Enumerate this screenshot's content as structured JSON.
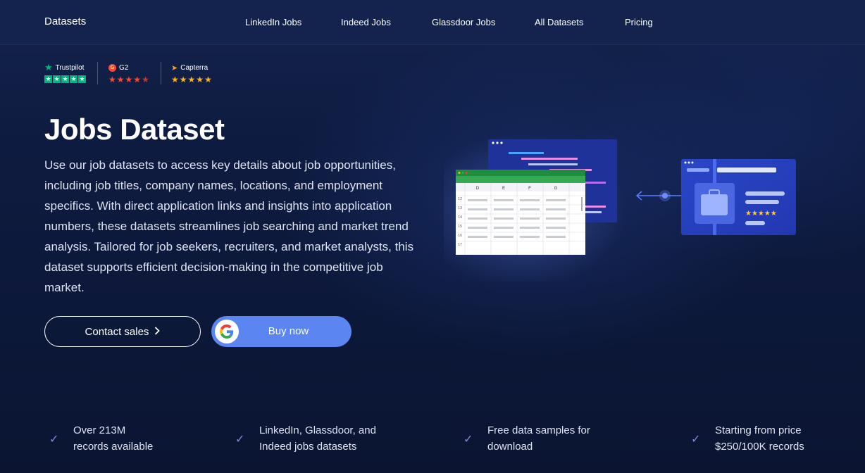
{
  "nav": {
    "brand": "Datasets",
    "links": [
      "LinkedIn Jobs",
      "Indeed Jobs",
      "Glassdoor Jobs",
      "All Datasets",
      "Pricing"
    ]
  },
  "ratings": {
    "trustpilot": "Trustpilot",
    "g2": "G2",
    "capterra": "Capterra"
  },
  "hero": {
    "title": "Jobs Dataset",
    "description": "Use our job datasets to access key details about job opportunities, including job titles, company names, locations, and employment specifics. With direct application links and insights into application numbers, these datasets streamlines job searching and market trend analysis. Tailored for job seekers, recruiters, and market analysts, this dataset supports efficient decision-making in the competitive job market."
  },
  "buttons": {
    "contact": "Contact sales",
    "buy": "Buy now"
  },
  "illustration": {
    "columns": [
      "D",
      "E",
      "F",
      "G"
    ],
    "rows": [
      "12",
      "13",
      "14",
      "15",
      "16",
      "17"
    ]
  },
  "features": [
    {
      "line1": "Over 213M",
      "line2": "records available"
    },
    {
      "line1": "LinkedIn, Glassdoor, and",
      "line2": "Indeed jobs datasets"
    },
    {
      "line1": "Free data samples for",
      "line2": "download"
    },
    {
      "line1": "Starting from price",
      "line2": "$250/100K records"
    }
  ],
  "colors": {
    "background": "#0b1532",
    "nav": "#13234d",
    "accent": "#5b85f0",
    "trustpilot": "#00b67a",
    "g2": "#ff492c",
    "capterra": "#ffb319"
  }
}
